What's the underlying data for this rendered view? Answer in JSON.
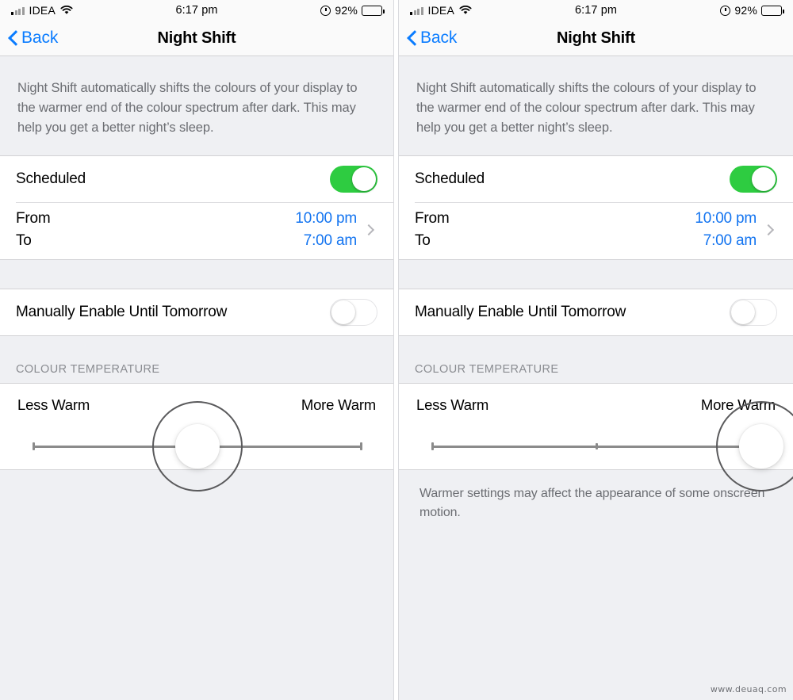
{
  "status_bar": {
    "carrier": "IDEA",
    "time": "6:17 pm",
    "battery_percent": "92%",
    "wifi_icon": "wifi-icon",
    "signal_icon": "cellular-signal-icon",
    "alarm_icon": "alarm-clock-icon",
    "battery_icon": "battery-icon"
  },
  "nav": {
    "back_label": "Back",
    "title": "Night Shift",
    "back_icon": "chevron-left-icon"
  },
  "description": "Night Shift automatically shifts the colours of your display to the warmer end of the colour spectrum after dark. This may help you get a better night’s sleep.",
  "scheduled": {
    "label": "Scheduled",
    "toggle_state": "on"
  },
  "schedule": {
    "from_label": "From",
    "to_label": "To",
    "from_value": "10:00 pm",
    "to_value": "7:00 am",
    "disclosure_icon": "chevron-right-icon"
  },
  "manual": {
    "label": "Manually Enable Until Tomorrow",
    "toggle_state": "off"
  },
  "colour_temperature": {
    "section_header": "COLOUR TEMPERATURE",
    "min_label": "Less Warm",
    "max_label": "More Warm",
    "left_panel_value_percent": 50,
    "right_panel_value_percent": 100
  },
  "footer_note": "Warmer settings may affect the appearance of some onscreen motion.",
  "watermark": "www.deuaq.com",
  "colors": {
    "accent_blue": "#0a7cff",
    "value_blue": "#1374f0",
    "toggle_on_green": "#2ecc41",
    "background_gray": "#eff0f3",
    "cell_white": "#ffffff",
    "secondary_text": "#6b6d72"
  }
}
